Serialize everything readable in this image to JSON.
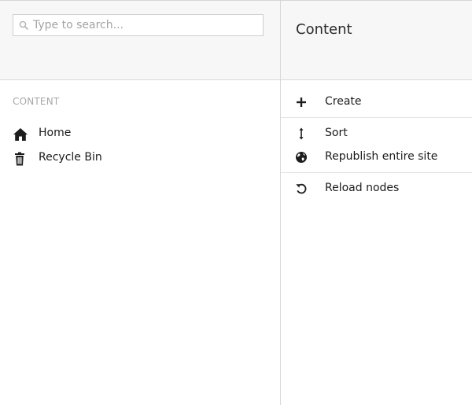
{
  "search": {
    "placeholder": "Type to search...",
    "value": ""
  },
  "tree": {
    "section_label": "CONTENT",
    "items": [
      {
        "label": "Home",
        "icon": "home-icon"
      },
      {
        "label": "Recycle Bin",
        "icon": "trash-icon"
      }
    ]
  },
  "actions": {
    "title": "Content",
    "items": [
      {
        "label": "Create",
        "icon": "plus-icon"
      },
      {
        "label": "Sort",
        "icon": "sort-icon"
      },
      {
        "label": "Republish entire site",
        "icon": "globe-icon"
      },
      {
        "label": "Reload nodes",
        "icon": "reload-icon"
      }
    ]
  },
  "colors": {
    "header_bg": "#f7f7f7",
    "border": "#d9d9d9",
    "icon": "#1d1d1d",
    "muted_text": "#a8a8a8"
  }
}
